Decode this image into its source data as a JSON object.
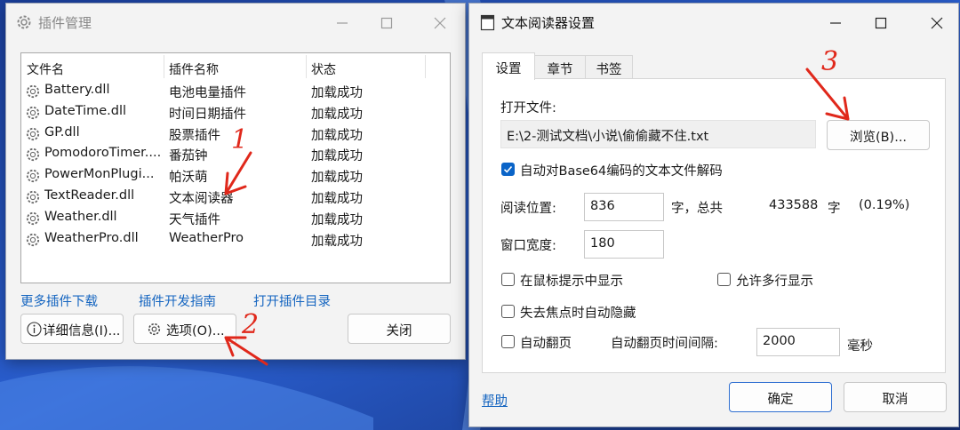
{
  "plugin_window": {
    "title": "插件管理",
    "columns": [
      "文件名",
      "插件名称",
      "状态"
    ],
    "plugins": [
      {
        "file": "Battery.dll",
        "name": "电池电量插件",
        "status": "加载成功"
      },
      {
        "file": "DateTime.dll",
        "name": "时间日期插件",
        "status": "加载成功"
      },
      {
        "file": "GP.dll",
        "name": "股票插件",
        "status": "加载成功"
      },
      {
        "file": "PomodoroTimer....",
        "name": "番茄钟",
        "status": "加载成功"
      },
      {
        "file": "PowerMonPlugi...",
        "name": "帕沃萌",
        "status": "加载成功"
      },
      {
        "file": "TextReader.dll",
        "name": "文本阅读器",
        "status": "加载成功"
      },
      {
        "file": "Weather.dll",
        "name": "天气插件",
        "status": "加载成功"
      },
      {
        "file": "WeatherPro.dll",
        "name": "WeatherPro",
        "status": "加载成功"
      }
    ],
    "links": {
      "more": "更多插件下载",
      "guide": "插件开发指南",
      "open_dir": "打开插件目录"
    },
    "buttons": {
      "details": "详细信息(I)...",
      "options": "选项(O)...",
      "close": "关闭"
    }
  },
  "settings_window": {
    "title": "文本阅读器设置",
    "tabs": [
      "设置",
      "章节",
      "书签"
    ],
    "open_file_label": "打开文件:",
    "file_path": "E:\\2-测试文档\\小说\\偷偷藏不住.txt",
    "browse_button": "浏览(B)...",
    "base64_checkbox": {
      "label": "自动对Base64编码的文本文件解码",
      "checked": true
    },
    "read_position": {
      "label": "阅读位置:",
      "value": "836",
      "unit_text": "字，总共",
      "total": "433588",
      "total_unit": "字",
      "percent": "(0.19%)"
    },
    "window_width": {
      "label": "窗口宽度:",
      "value": "180"
    },
    "show_in_tooltip": {
      "label": "在鼠标提示中显示",
      "checked": false
    },
    "allow_multiline": {
      "label": "允许多行显示",
      "checked": false
    },
    "auto_hide": {
      "label": "失去焦点时自动隐藏",
      "checked": false
    },
    "auto_page": {
      "label": "自动翻页",
      "checked": false
    },
    "page_interval": {
      "label": "自动翻页时间间隔:",
      "value": "2000",
      "unit": "毫秒"
    },
    "help_link": "帮助",
    "ok_button": "确定",
    "cancel_button": "取消"
  },
  "annotations": [
    "1",
    "2",
    "3"
  ],
  "colors": {
    "accent": "#0a64c8",
    "link": "#1565c0",
    "annotation": "#e0281b"
  }
}
